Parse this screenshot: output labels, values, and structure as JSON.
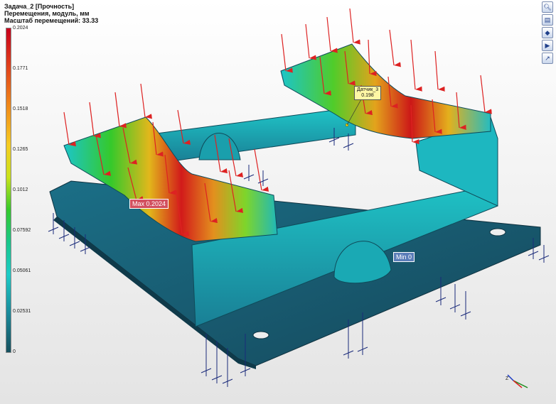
{
  "header": {
    "line1": "Задача_2 [Прочность]",
    "line2": "Перемещения, модуль, мм",
    "line3": "Масштаб перемещений: 33.33"
  },
  "legend": {
    "labels": [
      "0.2024",
      "0.1771",
      "0.1518",
      "0.1265",
      "0.1012",
      "0.07592",
      "0.05061",
      "0.02531",
      "0"
    ],
    "colors": {
      "max": "#c8001c",
      "mid": "#f5cc22",
      "low": "#1ccbc7",
      "min": "#17505e"
    }
  },
  "annotations": {
    "max_label": "Max 0.2024",
    "min_label": "Min 0",
    "sensor_name": "Датчик_3",
    "sensor_value": "0.198"
  },
  "axes": {
    "z": "Z"
  },
  "toolbar": {
    "icons": [
      "zoom-icon",
      "layers-icon",
      "view-cube-icon",
      "view-icon",
      "export-image-icon"
    ]
  }
}
